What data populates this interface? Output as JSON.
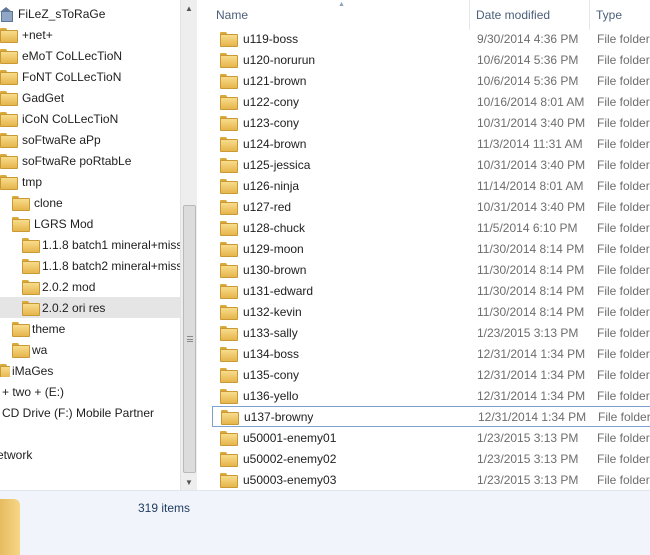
{
  "nav": {
    "items": [
      {
        "label": "FiLeZ_sToRaGe",
        "icon": "network-drive-icon",
        "selected": false
      },
      {
        "label": "+net+",
        "icon": "folder-icon"
      },
      {
        "label": "eMoT CoLLecTioN",
        "icon": "folder-icon"
      },
      {
        "label": "FoNT CoLLecTioN",
        "icon": "folder-icon"
      },
      {
        "label": "GadGet",
        "icon": "folder-icon"
      },
      {
        "label": "iCoN CoLLecTioN",
        "icon": "folder-icon"
      },
      {
        "label": "soFtwaRe aPp",
        "icon": "folder-icon"
      },
      {
        "label": "soFtwaRe poRtabLe",
        "icon": "folder-icon"
      },
      {
        "label": "tmp",
        "icon": "folder-icon"
      },
      {
        "label": "clone",
        "icon": "folder-icon"
      },
      {
        "label": "LGRS Mod",
        "icon": "folder-icon"
      },
      {
        "label": "1.1.8 batch1 mineral+miss",
        "icon": "folder-icon"
      },
      {
        "label": "1.1.8 batch2 mineral+miss",
        "icon": "folder-icon"
      },
      {
        "label": "2.0.2 mod",
        "icon": "folder-icon"
      },
      {
        "label": "2.0.2 ori res",
        "icon": "folder-icon",
        "selected": true
      },
      {
        "label": "theme",
        "icon": "folder-icon"
      },
      {
        "label": "wa",
        "icon": "folder-icon"
      },
      {
        "label": "iMaGes",
        "icon": "folder-icon"
      },
      {
        "label": "+ two + (E:)",
        "icon": "drive-icon"
      },
      {
        "label": "CD Drive (F:) Mobile Partner",
        "icon": "cd-drive-icon"
      },
      {
        "label": "etwork",
        "icon": "network-icon"
      }
    ]
  },
  "columns": {
    "name": "Name",
    "date": "Date modified",
    "type": "Type"
  },
  "files": [
    {
      "name": "u119-boss",
      "date": "9/30/2014 4:36 PM",
      "type": "File folder"
    },
    {
      "name": "u120-norurun",
      "date": "10/6/2014 5:36 PM",
      "type": "File folder"
    },
    {
      "name": "u121-brown",
      "date": "10/6/2014 5:36 PM",
      "type": "File folder"
    },
    {
      "name": "u122-cony",
      "date": "10/16/2014 8:01 AM",
      "type": "File folder"
    },
    {
      "name": "u123-cony",
      "date": "10/31/2014 3:40 PM",
      "type": "File folder"
    },
    {
      "name": "u124-brown",
      "date": "11/3/2014 11:31 AM",
      "type": "File folder"
    },
    {
      "name": "u125-jessica",
      "date": "10/31/2014 3:40 PM",
      "type": "File folder"
    },
    {
      "name": "u126-ninja",
      "date": "11/14/2014 8:01 AM",
      "type": "File folder"
    },
    {
      "name": "u127-red",
      "date": "10/31/2014 3:40 PM",
      "type": "File folder"
    },
    {
      "name": "u128-chuck",
      "date": "11/5/2014 6:10 PM",
      "type": "File folder"
    },
    {
      "name": "u129-moon",
      "date": "11/30/2014 8:14 PM",
      "type": "File folder"
    },
    {
      "name": "u130-brown",
      "date": "11/30/2014 8:14 PM",
      "type": "File folder"
    },
    {
      "name": "u131-edward",
      "date": "11/30/2014 8:14 PM",
      "type": "File folder"
    },
    {
      "name": "u132-kevin",
      "date": "11/30/2014 8:14 PM",
      "type": "File folder"
    },
    {
      "name": "u133-sally",
      "date": "1/23/2015 3:13 PM",
      "type": "File folder"
    },
    {
      "name": "u134-boss",
      "date": "12/31/2014 1:34 PM",
      "type": "File folder"
    },
    {
      "name": "u135-cony",
      "date": "12/31/2014 1:34 PM",
      "type": "File folder"
    },
    {
      "name": "u136-yello",
      "date": "12/31/2014 1:34 PM",
      "type": "File folder"
    },
    {
      "name": "u137-browny",
      "date": "12/31/2014 1:34 PM",
      "type": "File folder",
      "focused": true
    },
    {
      "name": "u50001-enemy01",
      "date": "1/23/2015 3:13 PM",
      "type": "File folder"
    },
    {
      "name": "u50002-enemy02",
      "date": "1/23/2015 3:13 PM",
      "type": "File folder"
    },
    {
      "name": "u50003-enemy03",
      "date": "1/23/2015 3:13 PM",
      "type": "File folder"
    }
  ],
  "status": {
    "item_count": "319 items"
  }
}
